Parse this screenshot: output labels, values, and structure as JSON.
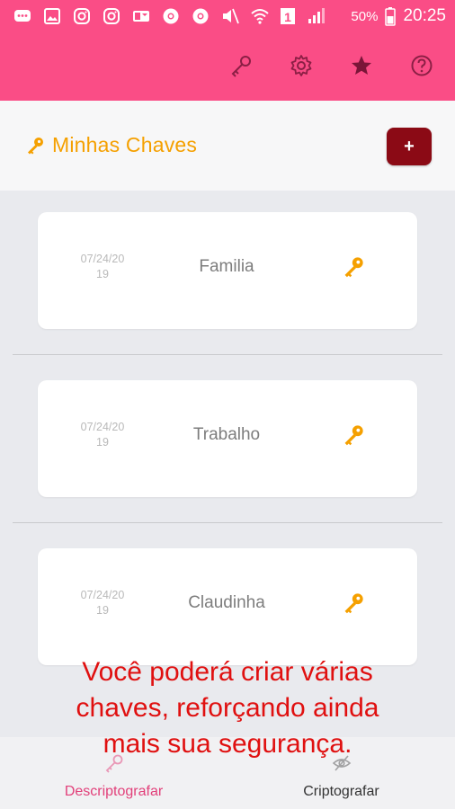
{
  "status_bar": {
    "battery_percent": "50%",
    "time": "20:25",
    "notification_badge": "1"
  },
  "toolbar": {
    "actions": [
      {
        "icon": "key-icon"
      },
      {
        "icon": "gear-icon"
      },
      {
        "icon": "star-icon"
      },
      {
        "icon": "help-icon"
      }
    ]
  },
  "header": {
    "title": "Minhas Chaves",
    "add_label": "+"
  },
  "keys": [
    {
      "date": "07/24/2019",
      "date_line1": "07/24/20",
      "date_line2": "19",
      "name": "Familia"
    },
    {
      "date": "07/24/2019",
      "date_line1": "07/24/20",
      "date_line2": "19",
      "name": "Trabalho"
    },
    {
      "date": "07/24/2019",
      "date_line1": "07/24/20",
      "date_line2": "19",
      "name": "Claudinha"
    }
  ],
  "overlay": {
    "line1": "Você poderá criar várias",
    "line2": "chaves, reforçando ainda",
    "line3": "mais sua segurança."
  },
  "bottom_nav": {
    "tabs": [
      {
        "label": "Descriptografar",
        "icon": "key-icon",
        "active": true
      },
      {
        "label": "Criptografar",
        "icon": "eye-off-icon",
        "active": false
      }
    ]
  },
  "colors": {
    "topbar": "#fa4d86",
    "accent": "#f5a000",
    "add_button": "#8b0a15",
    "active_tab": "#e2407a",
    "overlay_text": "#e01010"
  }
}
